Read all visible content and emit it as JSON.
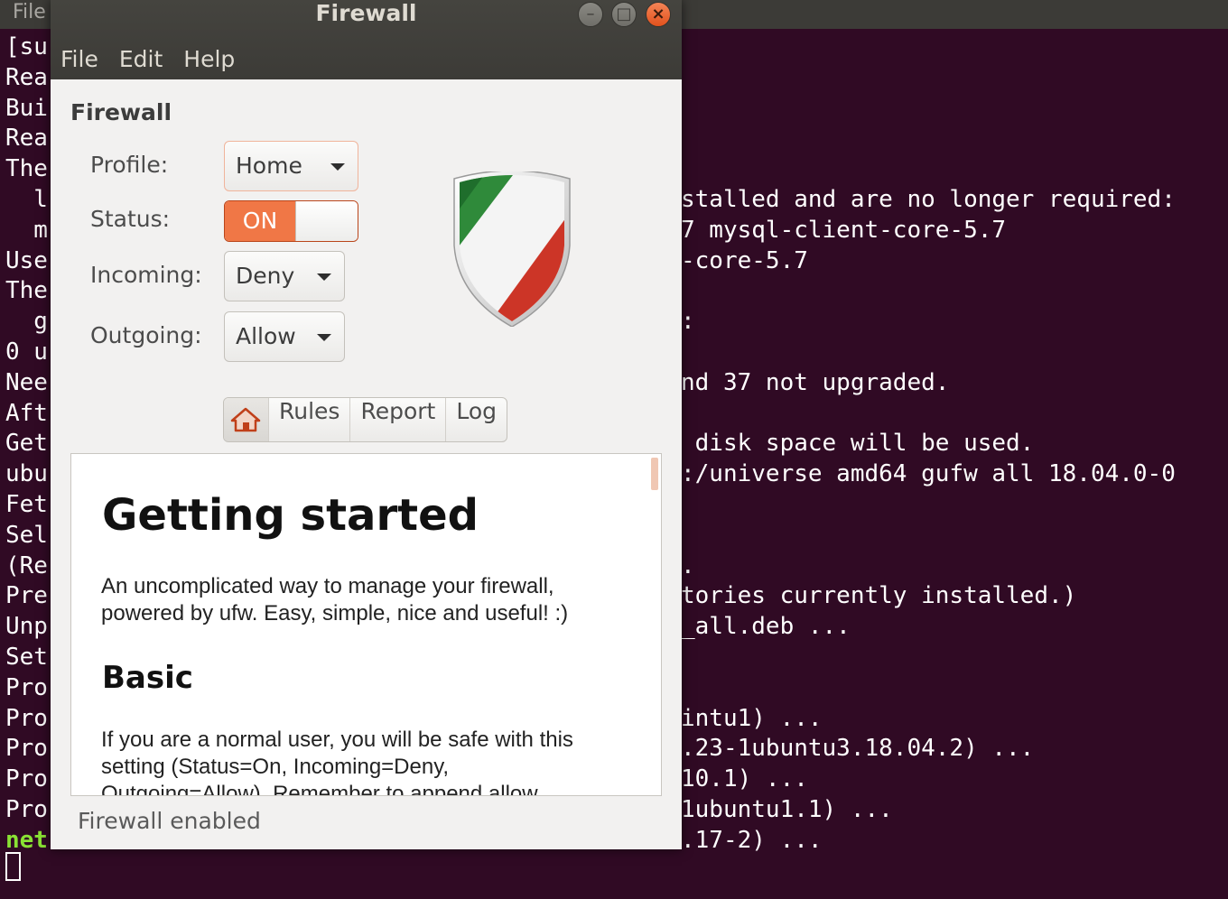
{
  "terminal": {
    "menu_label": "File",
    "left_lines": [
      "[su",
      "Rea",
      "Bui",
      "Rea",
      "The",
      "  l",
      "  m",
      "Use",
      "The",
      "  g",
      "0 u",
      "Nee",
      "Aft",
      "Get",
      "ubu",
      "Fet",
      "Sel",
      "(Re",
      "Pre",
      "Unp",
      "Set",
      "Pro",
      "Pro",
      "Pro",
      "Pro",
      "Pro",
      "net"
    ],
    "right_lines": [
      {
        "row": 5,
        "text": "stalled and are no longer required:"
      },
      {
        "row": 6,
        "text": "7 mysql-client-core-5.7"
      },
      {
        "row": 7,
        "text": "-core-5.7"
      },
      {
        "row": 9,
        "text": ":"
      },
      {
        "row": 11,
        "text": "nd 37 not upgraded."
      },
      {
        "row": 13,
        "text": " disk space will be used."
      },
      {
        "row": 14,
        "text": ":/universe amd64 gufw all 18.04.0-0"
      },
      {
        "row": 17,
        "text": "."
      },
      {
        "row": 18,
        "text": "tories currently installed.)"
      },
      {
        "row": 19,
        "text": "_all.deb ..."
      },
      {
        "row": 22,
        "text": "intu1) ..."
      },
      {
        "row": 23,
        "text": ".23-1ubuntu3.18.04.2) ..."
      },
      {
        "row": 24,
        "text": "10.1) ..."
      },
      {
        "row": 25,
        "text": "1ubuntu1.1) ..."
      },
      {
        "row": 26,
        "text": ".17-2) ..."
      }
    ]
  },
  "window": {
    "title": "Firewall",
    "controls": {
      "minimize": "–",
      "maximize": "□",
      "close": "×"
    },
    "menu": [
      "File",
      "Edit",
      "Help"
    ]
  },
  "firewall": {
    "section_title": "Firewall",
    "profile": {
      "label": "Profile:",
      "value": "Home"
    },
    "status": {
      "label": "Status:",
      "value": "ON"
    },
    "incoming": {
      "label": "Incoming:",
      "value": "Deny"
    },
    "outgoing": {
      "label": "Outgoing:",
      "value": "Allow"
    }
  },
  "tabs": {
    "home_icon": "home-icon",
    "items": [
      "Rules",
      "Report",
      "Log"
    ]
  },
  "content": {
    "heading": "Getting started",
    "intro_line1": "An uncomplicated way to manage your firewall,",
    "intro_line2": "powered by ufw. Easy, simple, nice and useful! :)",
    "subheading": "Basic",
    "basic_line1": "If you are a normal user, you will be safe with this",
    "basic_line2": "setting (Status=On, Incoming=Deny,",
    "basic_line3": "Outgoing=Allow). Remember to append allow"
  },
  "statusbar": {
    "text": "Firewall enabled"
  },
  "colors": {
    "terminal_bg": "#300a24",
    "accent": "#f07746",
    "titlebar": "#3c3b37"
  }
}
